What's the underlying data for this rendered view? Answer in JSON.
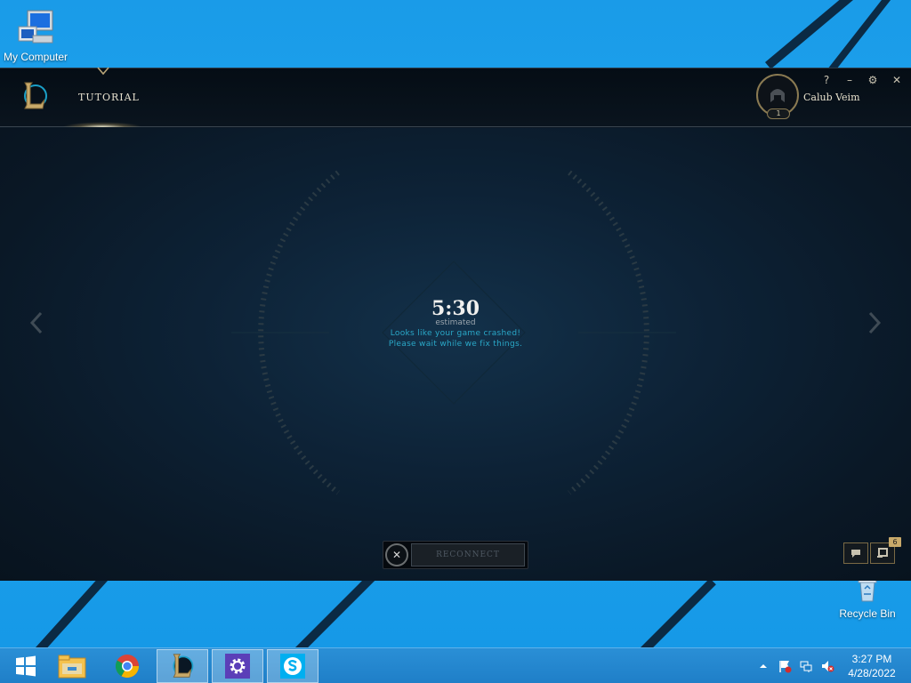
{
  "desktop": {
    "icons": [
      {
        "label": "My Computer"
      },
      {
        "label": "Recycle Bin"
      }
    ]
  },
  "client": {
    "nav": {
      "tutorial_label": "TUTORIAL"
    },
    "window_buttons": {
      "help": "?",
      "minimize": "–",
      "settings": "⚙",
      "close": "✕"
    },
    "profile": {
      "name": "Calub Veim",
      "level": "1"
    },
    "queue": {
      "timer": "5:30",
      "estimated_label": "estimated",
      "message_line1": "Looks like your game crashed!",
      "message_line2": "Please wait while we fix things."
    },
    "reconnect": {
      "cancel_glyph": "✕",
      "label": "RECONNECT"
    },
    "notifications_count": "6"
  },
  "taskbar": {
    "clock_time": "3:27 PM",
    "clock_date": "4/28/2022"
  },
  "colors": {
    "desktop_bg": "#1a9be8",
    "client_bg": "#0a1724",
    "accent_gold": "#c8a96a",
    "message_teal": "#2aa8c8",
    "taskbar": "#1f7fc8"
  }
}
